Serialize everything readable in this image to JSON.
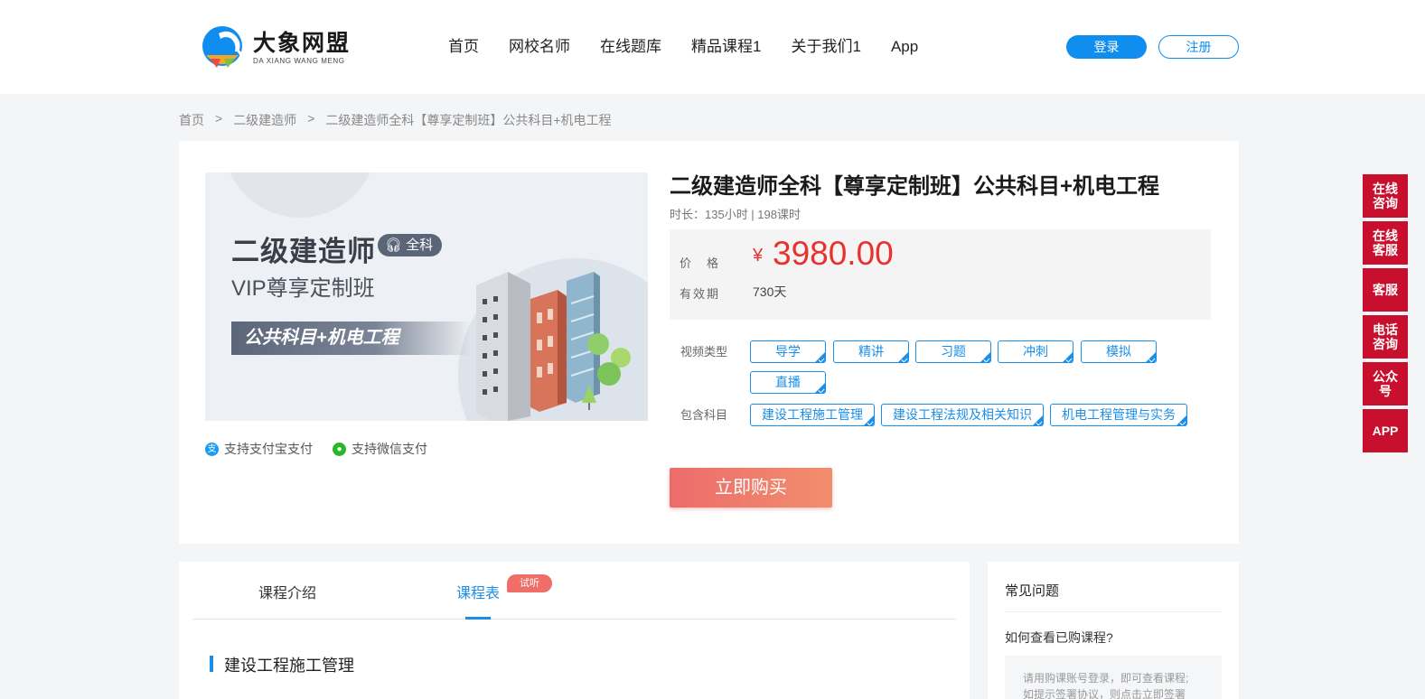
{
  "header": {
    "logo_cn": "大象网盟",
    "logo_en": "DA XIANG WANG MENG",
    "nav": [
      "首页",
      "网校名师",
      "在线题库",
      "精品课程1",
      "关于我们1",
      "App"
    ],
    "login_label": "登录",
    "register_label": "注册"
  },
  "breadcrumb": [
    "首页",
    ">",
    "二级建造师",
    ">",
    "二级建造师全科【尊享定制班】公共科目+机电工程"
  ],
  "banner": {
    "title": "二级建造师",
    "tag": "全科",
    "subtitle": "VIP尊享定制班",
    "strip": "公共科目+机电工程"
  },
  "payment": {
    "alipay": "支持支付宝支付",
    "wechat": "支持微信支付"
  },
  "course": {
    "title": "二级建造师全科【尊享定制班】公共科目+机电工程",
    "duration": "时长：135小时 | 198课时",
    "price_label": "价　格",
    "currency": "¥",
    "price": "3980.00",
    "validity_label": "有效期",
    "validity": "730天",
    "video_type_label": "视频类型",
    "video_types": [
      "导学",
      "精讲",
      "习题",
      "冲刺",
      "模拟",
      "直播"
    ],
    "subjects_label": "包含科目",
    "subjects": [
      "建设工程施工管理",
      "建设工程法规及相关知识",
      "机电工程管理与实务"
    ],
    "buy_label": "立即购买"
  },
  "detail": {
    "tab_intro": "课程介绍",
    "tab_schedule": "课程表",
    "trial_badge": "试听",
    "section_title": "建设工程施工管理"
  },
  "faq": {
    "title": "常见问题",
    "question": "如何查看已购课程?",
    "answer_line1": "请用购课账号登录，即可查看课程;",
    "answer_line2": "如提示签署协议，则点击立即签署"
  },
  "side_tools": [
    "在线咨询",
    "在线客服",
    "客服",
    "电话咨询",
    "公众号",
    "APP"
  ],
  "colors": {
    "brand_blue": "#0f8ef0",
    "price_red": "#e8322c",
    "side_red": "#c8102e"
  }
}
